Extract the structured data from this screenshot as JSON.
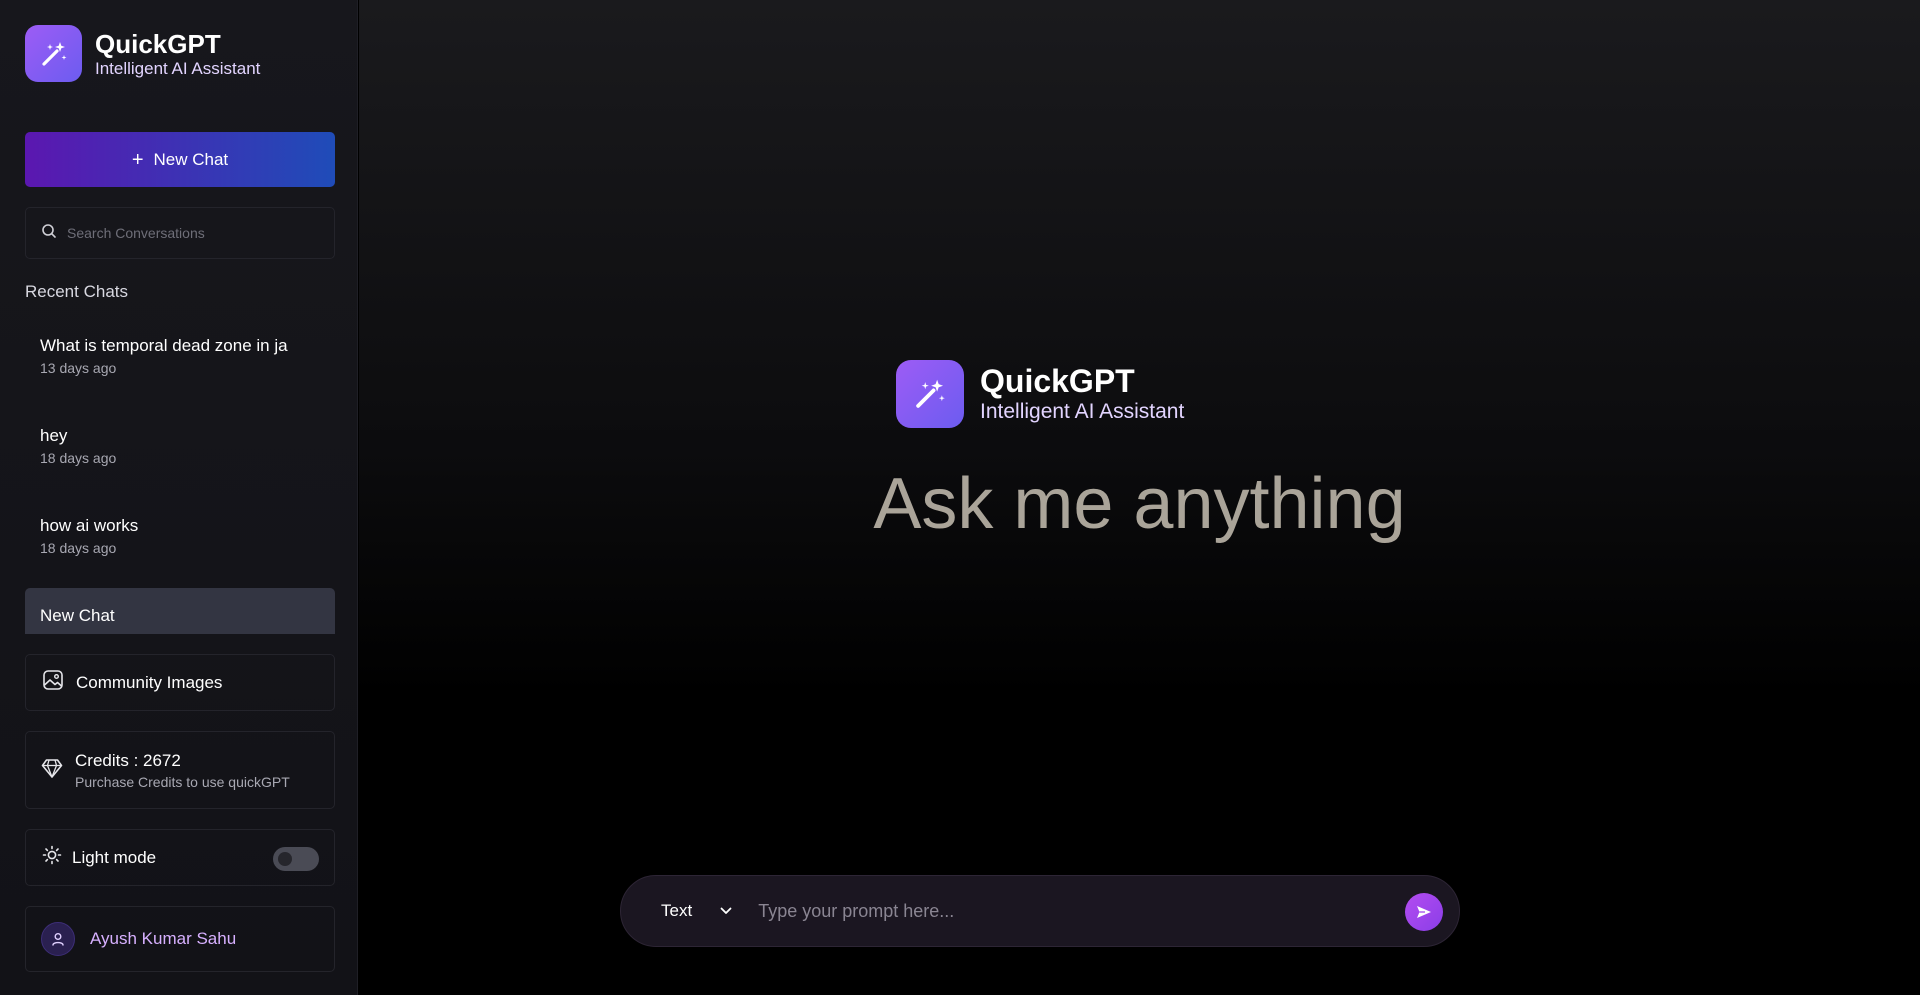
{
  "app": {
    "title": "QuickGPT",
    "subtitle": "Intelligent AI Assistant",
    "logo_icon": "magic-wand-sparkles-icon",
    "accent": "#8b5cf6"
  },
  "sidebar": {
    "new_chat_label": "New Chat",
    "search_placeholder": "Search Conversations",
    "recent_title": "Recent Chats",
    "chats": [
      {
        "title": "What is temporal dead zone in ja",
        "date": "13 days ago"
      },
      {
        "title": "hey",
        "date": "18 days ago"
      },
      {
        "title": "how ai works",
        "date": "18 days ago"
      },
      {
        "title": "New Chat",
        "date": "",
        "active": true
      }
    ],
    "community_label": "Community Images",
    "credits_label": "Credits : 2672",
    "credits_sub": "Purchase Credits to use quickGPT",
    "light_mode_label": "Light mode",
    "light_mode_on": false,
    "user_name": "Ayush Kumar Sahu"
  },
  "main": {
    "brand_title": "QuickGPT",
    "brand_sub": "Intelligent AI Assistant",
    "headline": "Ask me anything",
    "mode_selected": "Text",
    "prompt_placeholder": "Type your prompt here..."
  }
}
